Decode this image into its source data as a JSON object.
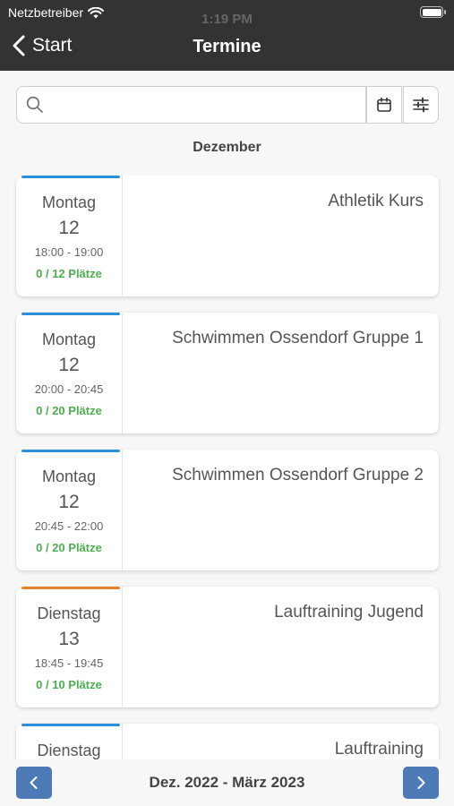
{
  "status_bar": {
    "carrier": "Netzbetreiber",
    "time": "1:19 PM"
  },
  "nav": {
    "back_label": "Start",
    "title": "Termine"
  },
  "search": {
    "value": "",
    "placeholder": ""
  },
  "month_header": "Dezember",
  "events": [
    {
      "day": "Montag",
      "date": "12",
      "time": "18:00 - 19:00",
      "seats": "0 / 12 Plätze",
      "title": "Athletik Kurs",
      "accent": "#2d8fd9"
    },
    {
      "day": "Montag",
      "date": "12",
      "time": "20:00 - 20:45",
      "seats": "0 / 20 Plätze",
      "title": "Schwimmen Ossendorf Gruppe 1",
      "accent": "#2d8fd9"
    },
    {
      "day": "Montag",
      "date": "12",
      "time": "20:45 - 22:00",
      "seats": "0 / 20 Plätze",
      "title": "Schwimmen Ossendorf Gruppe 2",
      "accent": "#2d8fd9"
    },
    {
      "day": "Dienstag",
      "date": "13",
      "time": "18:45 - 19:45",
      "seats": "0 / 10 Plätze",
      "title": "Lauftraining Jugend",
      "accent": "#e8822a"
    },
    {
      "day": "Dienstag",
      "date": "",
      "time": "",
      "seats": "",
      "title": "Lauftraining",
      "accent": "#2d8fd9"
    }
  ],
  "pagination": {
    "range": "Dez. 2022 - März 2023"
  },
  "icons": {
    "back": "chevron-left-icon",
    "search": "search-icon",
    "calendar": "calendar-icon",
    "filter": "sliders-icon",
    "prev": "chevron-left-icon",
    "next": "chevron-right-icon",
    "wifi": "wifi-icon",
    "battery": "battery-icon"
  },
  "colors": {
    "topbar": "#333333",
    "accent_blue": "#2d8fd9",
    "accent_orange": "#e8822a",
    "seats_green": "#4caf50",
    "pagination_button": "#4f7ab8"
  }
}
